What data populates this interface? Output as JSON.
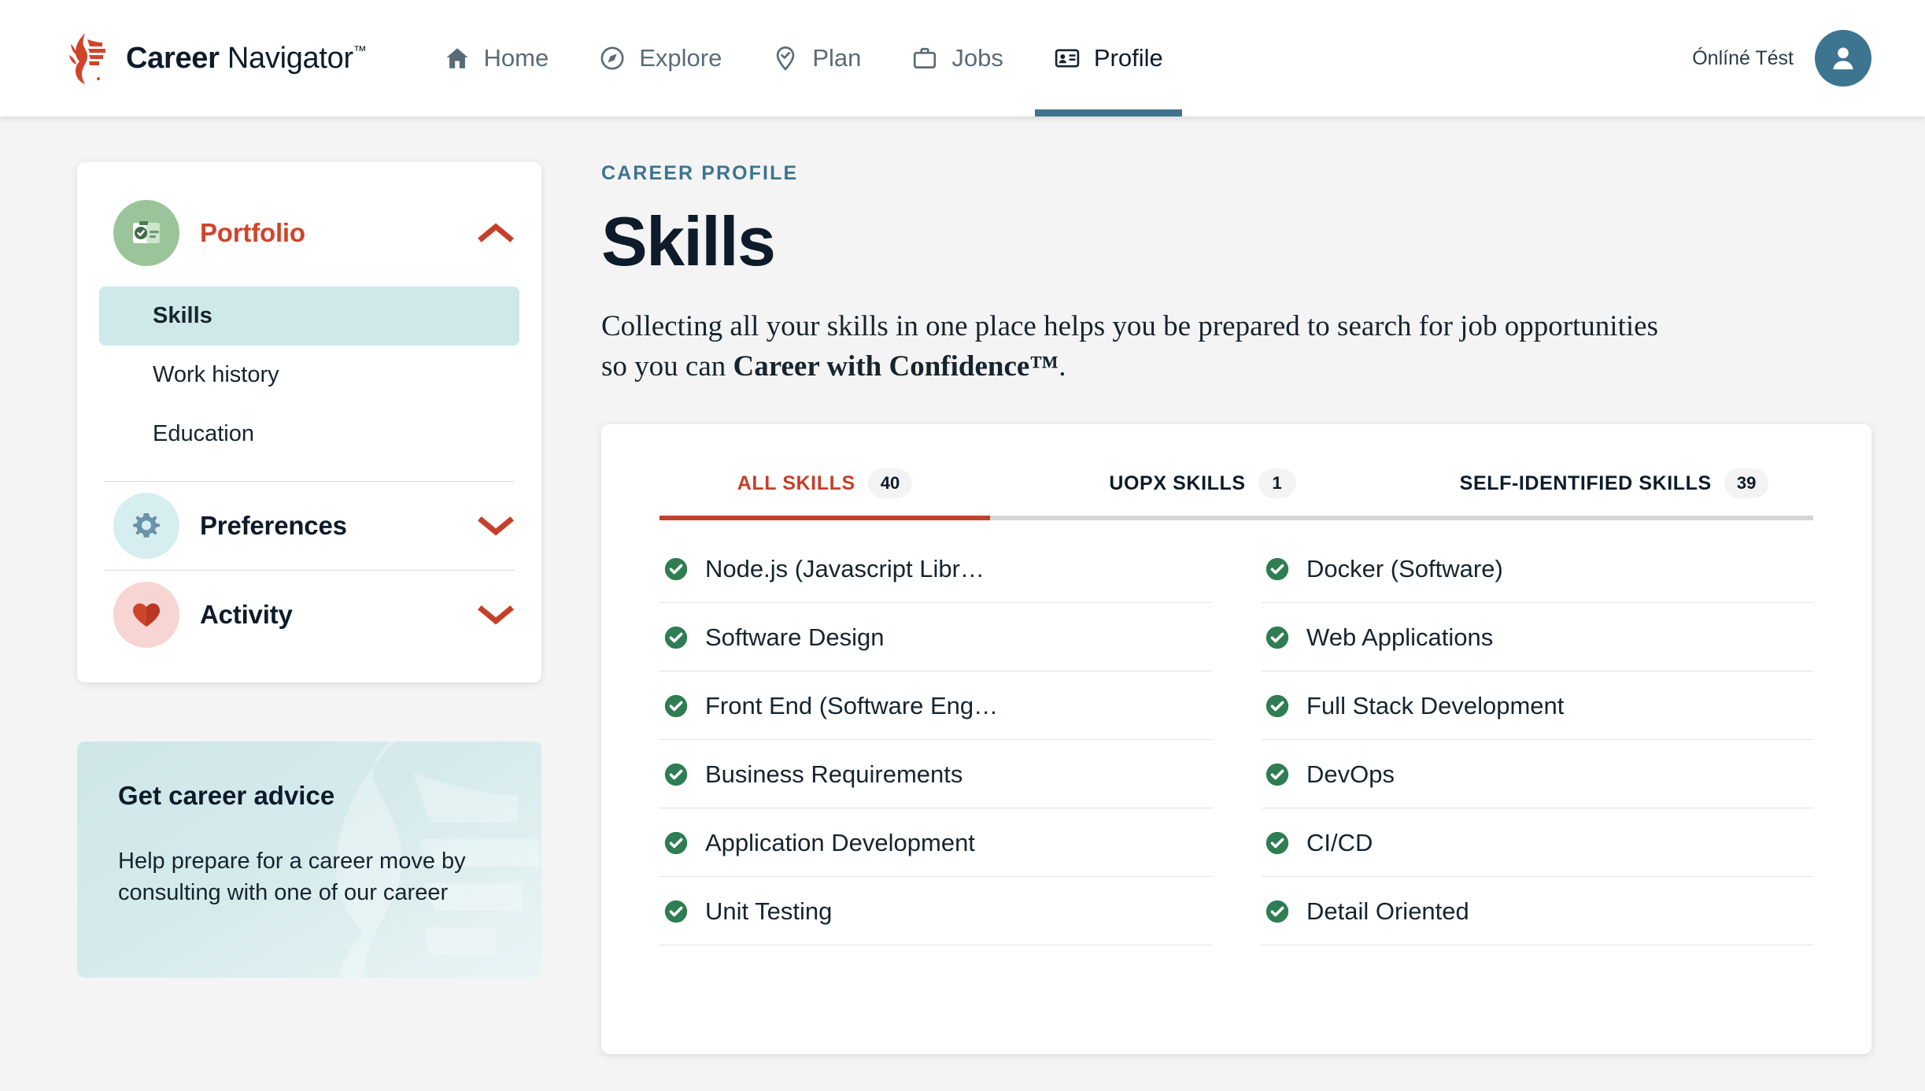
{
  "brand": {
    "name_bold": "Career",
    "name_light": "Navigator",
    "trademark": "™"
  },
  "nav": {
    "items": [
      {
        "label": "Home",
        "icon": "home-icon",
        "active": false
      },
      {
        "label": "Explore",
        "icon": "compass-icon",
        "active": false
      },
      {
        "label": "Plan",
        "icon": "pin-check-icon",
        "active": false
      },
      {
        "label": "Jobs",
        "icon": "briefcase-icon",
        "active": false
      },
      {
        "label": "Profile",
        "icon": "id-card-icon",
        "active": true
      }
    ],
    "active_underline_color": "#3d7490"
  },
  "user": {
    "name": "Ónlíné Tést",
    "avatar_color": "#3d7490"
  },
  "sidebar": {
    "sections": [
      {
        "title": "Portfolio",
        "icon": "portfolio-badge-icon",
        "expanded": true,
        "chevron": "chevron-up-icon",
        "items": [
          {
            "label": "Skills",
            "active": true
          },
          {
            "label": "Work history",
            "active": false
          },
          {
            "label": "Education",
            "active": false
          }
        ]
      },
      {
        "title": "Preferences",
        "icon": "gear-icon",
        "expanded": false,
        "chevron": "chevron-down-icon",
        "items": []
      },
      {
        "title": "Activity",
        "icon": "heart-icon",
        "expanded": false,
        "chevron": "chevron-down-icon",
        "items": []
      }
    ]
  },
  "promo": {
    "title": "Get career advice",
    "body": "Help prepare for a career move by consulting with one of our career"
  },
  "main": {
    "eyebrow": "CAREER PROFILE",
    "title": "Skills",
    "lede_part1": "Collecting all your skills in one place helps you be prepared to search for job opportunities so you can ",
    "lede_bold": "Career with Confidence™",
    "lede_part2": ".",
    "tabs": [
      {
        "label": "ALL SKILLS",
        "count": "40",
        "active": true
      },
      {
        "label": "UOPX SKILLS",
        "count": "1",
        "active": false
      },
      {
        "label": "SELF-IDENTIFIED SKILLS",
        "count": "39",
        "active": false
      }
    ],
    "skills": [
      "Node.js (Javascript Libr…",
      "Docker (Software)",
      "Software Design",
      "Web Applications",
      "Front End (Software Eng…",
      "Full Stack Development",
      "Business Requirements",
      "DevOps",
      "Application Development",
      "CI/CD",
      "Unit Testing",
      "Detail Oriented"
    ]
  },
  "colors": {
    "brand_red": "#c4402a",
    "accent_blue": "#3d7490",
    "check_green": "#2f7d52",
    "page_bg": "#f4f4f4"
  }
}
